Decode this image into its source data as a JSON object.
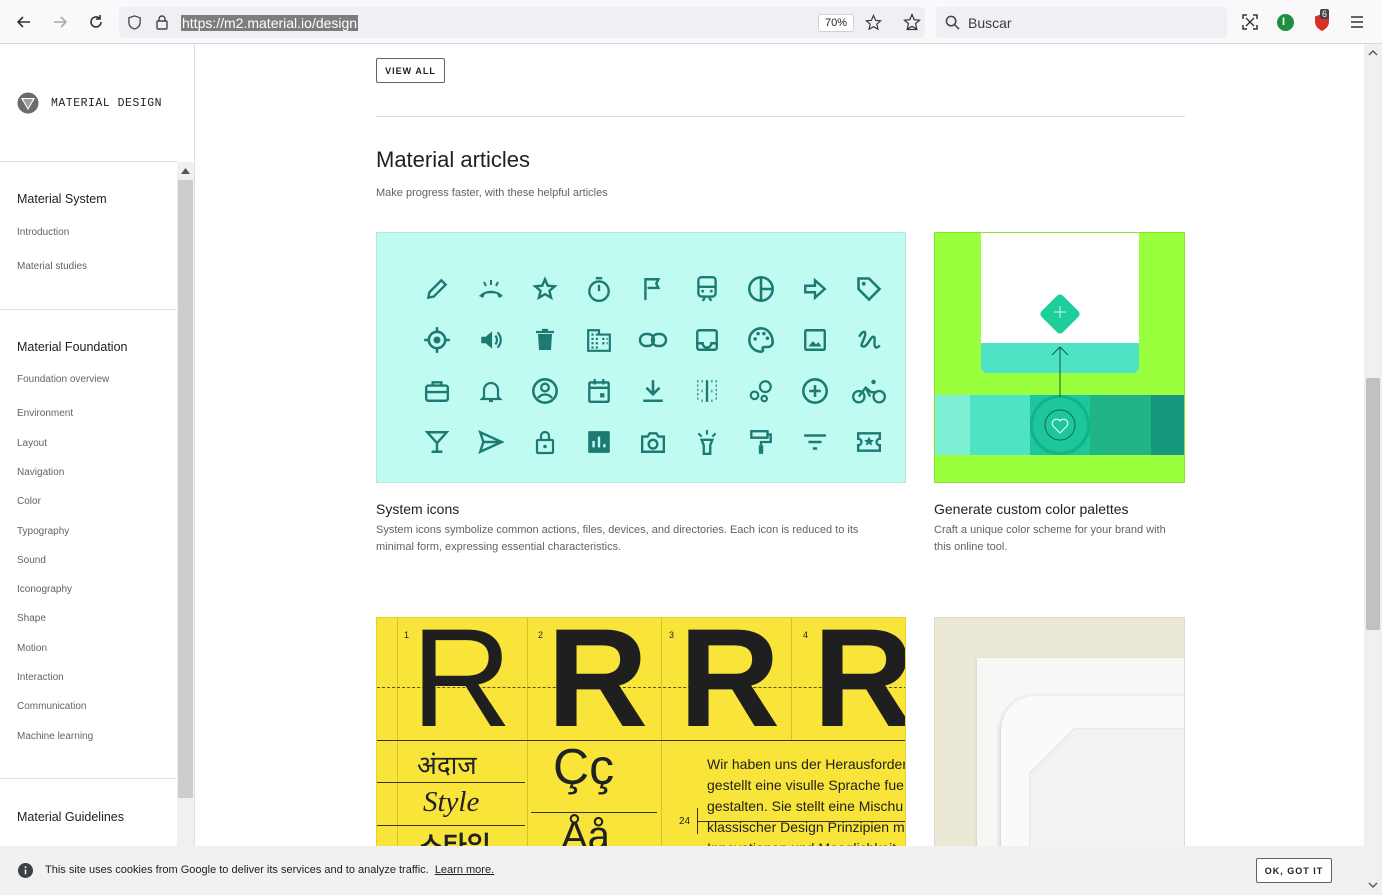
{
  "browser": {
    "url": "https://m2.material.io/design",
    "zoom": "70%",
    "search_placeholder": "Buscar",
    "notification_count": "6"
  },
  "sidebar": {
    "brand": "MATERIAL DESIGN",
    "sections": [
      {
        "heading": "Material System",
        "items": [
          "Introduction",
          "Material studies"
        ]
      },
      {
        "heading": "Material Foundation",
        "items": [
          "Foundation overview",
          "Environment",
          "Layout",
          "Navigation",
          "Color",
          "Typography",
          "Sound",
          "Iconography",
          "Shape",
          "Motion",
          "Interaction",
          "Communication",
          "Machine learning"
        ]
      },
      {
        "heading": "Material Guidelines",
        "items": []
      }
    ]
  },
  "main": {
    "view_all": "VIEW ALL",
    "section_title": "Material articles",
    "section_subtitle": "Make progress faster, with these helpful articles",
    "cards": [
      {
        "title": "System icons",
        "desc": "System icons symbolize common actions, files, devices, and directories. Each icon is reduced to its minimal form, expressing essential characteristics."
      },
      {
        "title": "Generate custom color palettes",
        "desc": "Craft a unique color scheme for your brand with this online tool."
      }
    ],
    "typography_card": {
      "column_numbers": [
        "1",
        "2",
        "3",
        "4"
      ],
      "glyph": "R",
      "samples": [
        "अंदाज",
        "Style",
        "스타일",
        "Çç",
        "Åå"
      ],
      "baseline_number": "24",
      "german_text": [
        "Wir haben uns der Herausforder",
        "gestellt eine visulle Sprache fue",
        "gestalten. Sie stellt eine Mischu",
        "klassischer Design Prinzipien m",
        "Innovationen und Moeglichkeit"
      ]
    }
  },
  "cookie": {
    "text": "This site uses cookies from Google to deliver its services and to analyze traffic.",
    "link": "Learn more.",
    "ok": "OK, GOT IT"
  },
  "colors": {
    "icons_bg": "#c0fbf2",
    "icons_fg": "#1d7a72",
    "palette_bg": "#9aff3c",
    "typo_bg": "#f9e43a",
    "shape_bg": "#ebe8d6"
  }
}
